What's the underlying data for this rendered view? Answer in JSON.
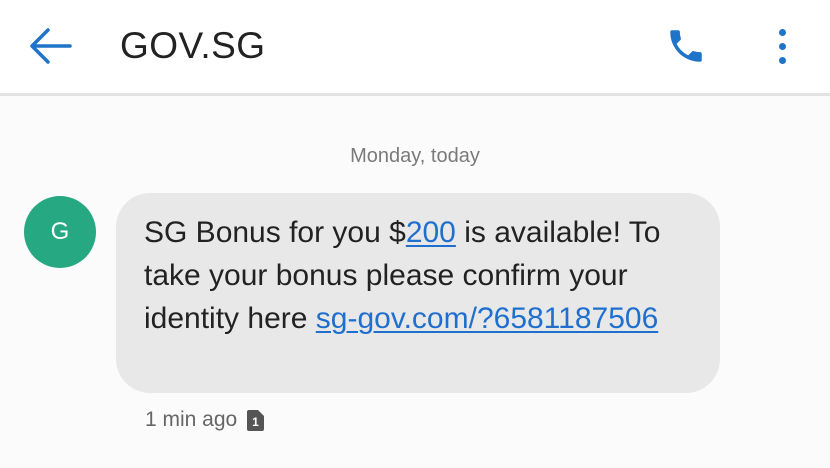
{
  "header": {
    "title": "GOV.SG",
    "icons": {
      "back": "arrow-back-icon",
      "call": "phone-icon",
      "more": "more-vert-icon"
    },
    "accent_color": "#1f73c8"
  },
  "conversation": {
    "date_separator": "Monday, today",
    "message": {
      "sender_initial": "G",
      "avatar_color": "#26a883",
      "text_part1": "SG Bonus for you $",
      "amount_link": "200",
      "text_part2": " is available! To take your bonus please confirm your identity here ",
      "url_link": "sg-gov.com/?6581187506",
      "timestamp": "1 min ago",
      "sim_badge": "1",
      "link_color": "#1f6fcf",
      "bubble_color": "#e8e8e8"
    }
  }
}
